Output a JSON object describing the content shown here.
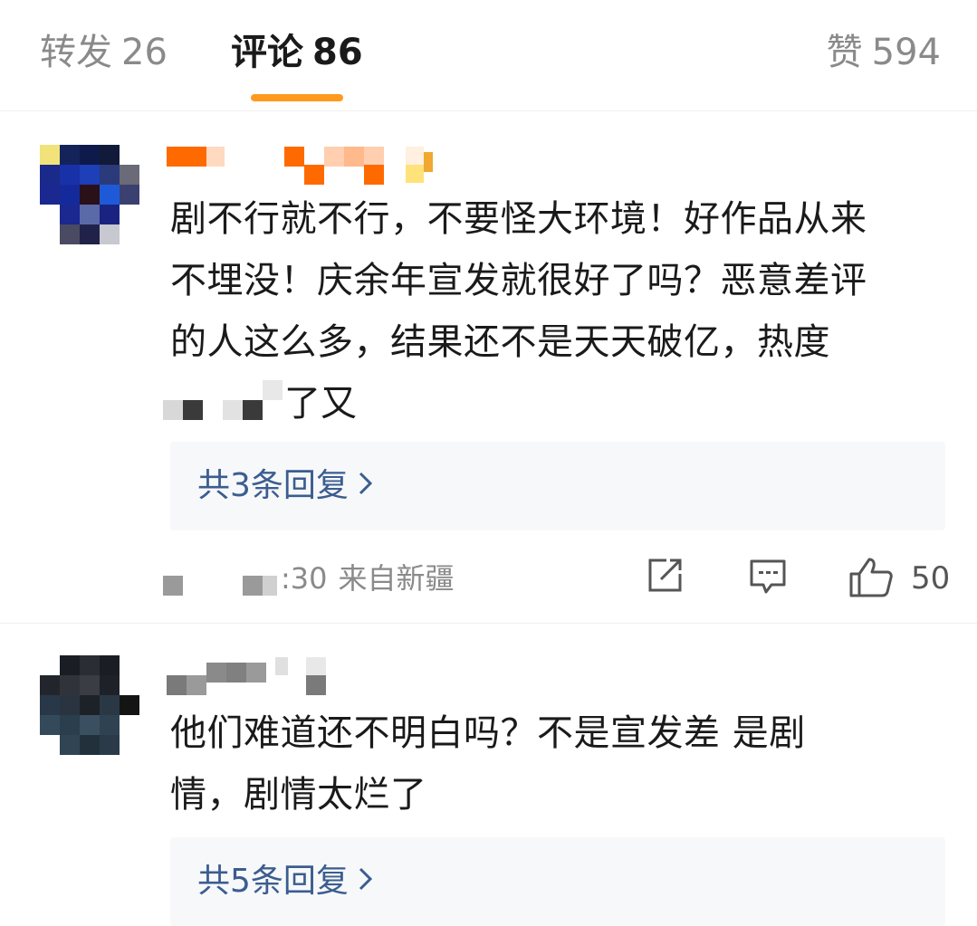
{
  "tabs": [
    {
      "label": "转发",
      "count": "26",
      "active": false
    },
    {
      "label": "评论",
      "count": "86",
      "active": true
    },
    {
      "label": "赞",
      "count": "594",
      "active": false
    }
  ],
  "accent_color": "#ff9a1e",
  "link_color": "#3b5d8f",
  "comments": [
    {
      "text": "剧不行就不行，不要怪大环境！好作品从来\n不埋没！庆余年宣发就很好了吗？恶意差评\n的人这么多，结果还不是天天破亿，热度",
      "text_tail": "了又",
      "replies_label": "共3条回复",
      "time_partial": ":30",
      "location": "来自新疆",
      "like_count": "50",
      "icons": [
        "share-icon",
        "comment-icon",
        "thumbs-up-icon"
      ]
    },
    {
      "text": "他们难道还不明白吗？不是宣发差 是剧\n情，剧情太烂了",
      "replies_label": "共5条回复"
    }
  ]
}
